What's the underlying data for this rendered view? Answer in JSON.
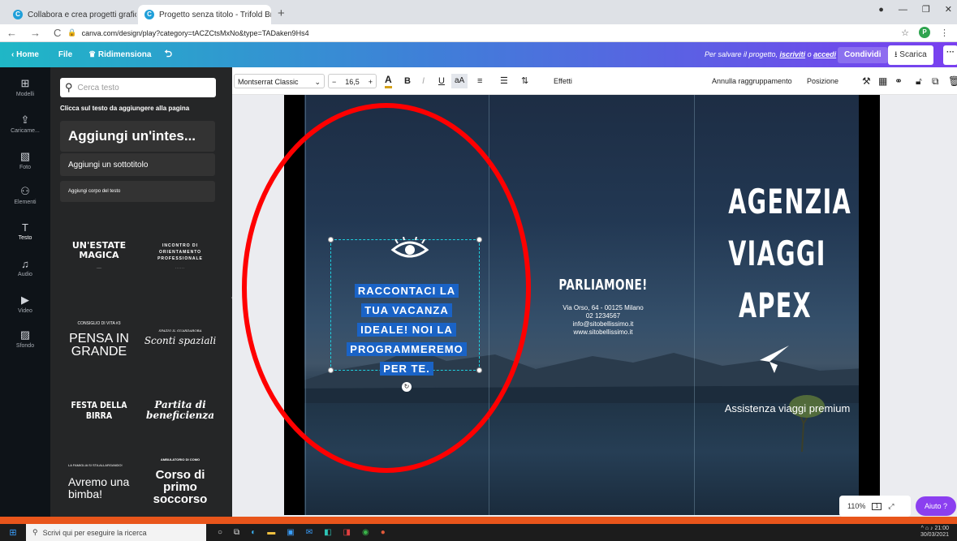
{
  "browser": {
    "tabs": [
      {
        "label": "Collabora e crea progetti grafici",
        "close": "×"
      },
      {
        "label": "Progetto senza titolo - Trifold Br…",
        "close": "×"
      }
    ],
    "new_tab": "+",
    "nav_back": "←",
    "nav_forward": "→",
    "nav_reload": "C",
    "url": "canva.com/design/play?category=tACZCtsMxNo&type=TADaken9Hs4",
    "profile_initial": "P",
    "window_controls": [
      "—",
      "❐",
      "✕"
    ]
  },
  "canva_top": {
    "home": "Home",
    "file": "File",
    "resize": "Ridimensiona",
    "undo": "⮌",
    "save_note_prefix": "Per salvare il progetto, ",
    "save_note_signup": "iscriviti",
    "save_note_mid": " o ",
    "save_note_login": "accedi",
    "share": "Condividi",
    "download": "Scarica",
    "more": "···"
  },
  "rail": [
    {
      "label": "Modelli",
      "icon": "template-icon"
    },
    {
      "label": "Caricame...",
      "icon": "upload-icon"
    },
    {
      "label": "Foto",
      "icon": "photo-icon"
    },
    {
      "label": "Elementi",
      "icon": "elements-icon"
    },
    {
      "label": "Testo",
      "icon": "text-icon"
    },
    {
      "label": "Audio",
      "icon": "audio-icon"
    },
    {
      "label": "Video",
      "icon": "video-icon"
    },
    {
      "label": "Sfondo",
      "icon": "background-icon"
    }
  ],
  "panel": {
    "search_placeholder": "Cerca testo",
    "hint": "Clicca sul testo da aggiungere alla pagina",
    "add_heading": "Aggiungi un'intes...",
    "add_subtitle": "Aggiungi un sottotitolo",
    "add_body": "Aggiungi corpo del testo",
    "templates": [
      {
        "title": "UN'ESTATE MAGICA",
        "sub": ""
      },
      {
        "title": "INCONTRO DI ORIENTAMENTO PROFESSIONALE",
        "sub": ""
      },
      {
        "title": "PENSA IN GRANDE",
        "sub": "CONSIGLIO DI VITA #3"
      },
      {
        "title": "Sconti spaziali",
        "sub": "SPAZIO IL GUARDAROBA"
      },
      {
        "title": "FESTA DELLA BIRRA",
        "sub": ""
      },
      {
        "title": "Partita di beneficienza",
        "sub": ""
      },
      {
        "title": "Avremo una bimba!",
        "sub": "LA FAMIGLIA SI STA ALLARGANDO!"
      },
      {
        "title": "Corso di primo soccorso",
        "sub": "AMBULATORIO DI COMO"
      }
    ]
  },
  "toolbar": {
    "font": "Montserrat Classic",
    "size": "16,5",
    "minus": "−",
    "plus": "+",
    "bold": "B",
    "italic": "I",
    "underline": "U",
    "case": "aA",
    "effects": "Effetti",
    "ungroup": "Annulla raggruppamento",
    "position": "Posizione"
  },
  "brochure": {
    "cta": "RACCONTACI LA TUA VACANZA IDEALE! NOI LA PROGRAMMEREMO PER TE.",
    "cta_lines": [
      "RACCONTACI LA",
      "TUA VACANZA",
      "IDEALE! NOI LA",
      "PROGRAMMEREMO",
      "PER TE."
    ],
    "contact_title": "PARLIAMONE!",
    "address": "Via Orso, 64 - 00125 Milano",
    "phone": "02 1234567",
    "email": "info@sitobellissimo.it",
    "website": "www.sitobellissimo.it",
    "agency_lines": [
      "AGENZIA",
      "VIAGGI",
      "APEX"
    ],
    "tagline": "Assistenza viaggi premium"
  },
  "zoom": {
    "level": "110%",
    "page": "1"
  },
  "help": "Aiuto ?",
  "taskbar": {
    "search": "Scrivi qui per eseguire la ricerca",
    "time": "21:00",
    "date": "30/03/2021"
  },
  "colors": {
    "slide_background": "#e8551b",
    "annotation_ellipse": "#ff0000",
    "selection_highlight": "#1a63c6",
    "canva_purple": "#8b3ff0"
  }
}
